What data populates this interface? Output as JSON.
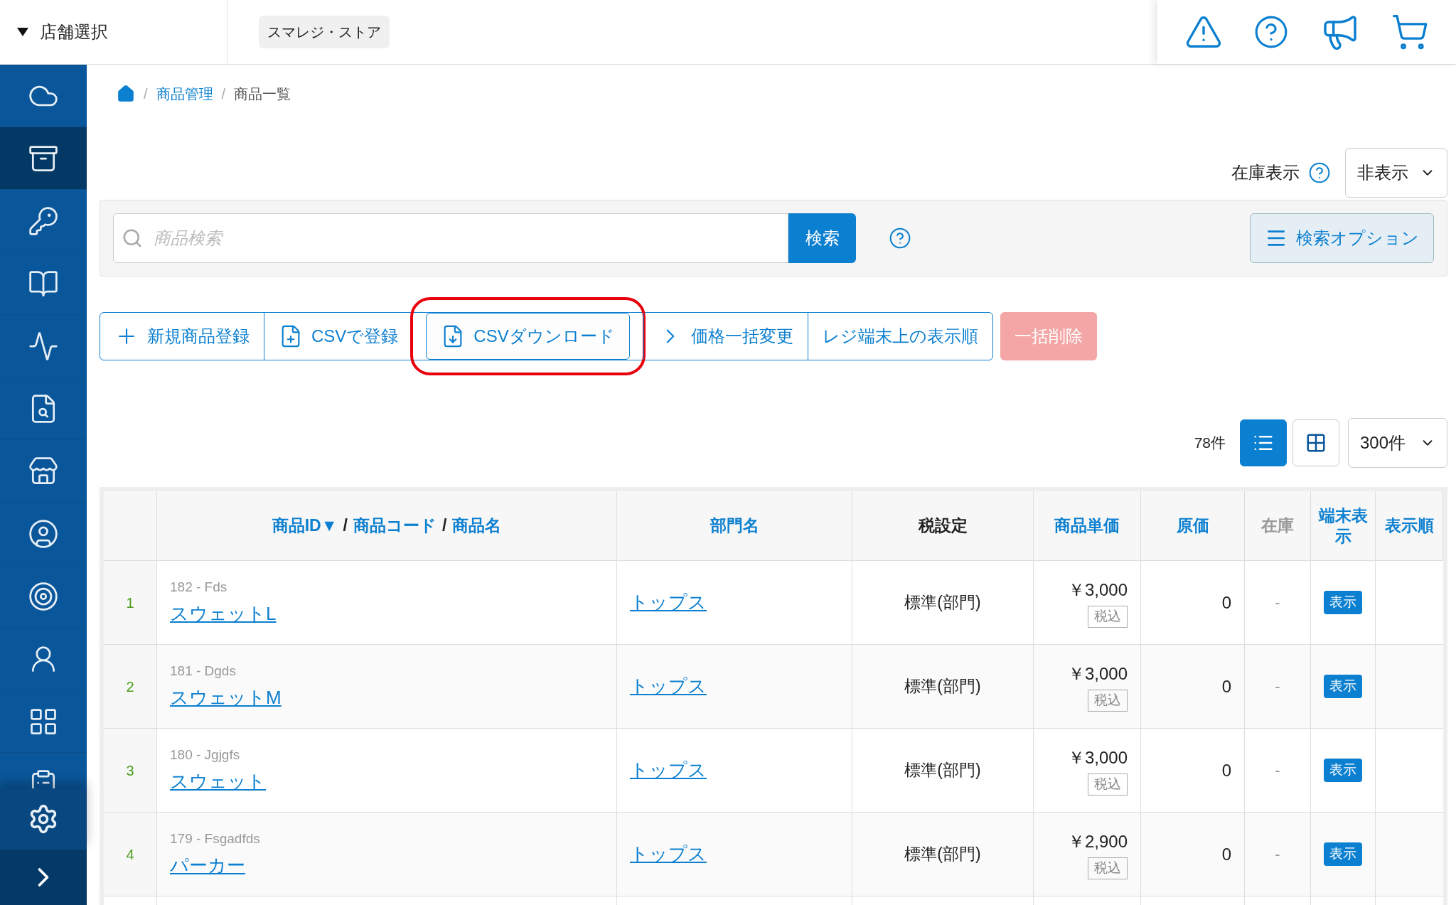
{
  "store_selector": {
    "label": "店舗選択"
  },
  "store_name": "スマレジ・ストア",
  "sidebar": {
    "items": [
      {
        "selected": false
      },
      {
        "selected": true
      },
      {
        "selected": false
      },
      {
        "selected": false
      },
      {
        "selected": false
      },
      {
        "selected": false
      },
      {
        "selected": false
      },
      {
        "selected": false
      },
      {
        "selected": false
      },
      {
        "selected": false
      },
      {
        "selected": false
      },
      {
        "selected": false
      }
    ]
  },
  "breadcrumb": [
    {
      "label": "商品管理",
      "kind": "link"
    },
    {
      "label": "商品一覧",
      "kind": "current"
    }
  ],
  "breadcrumb_separator": "/",
  "stock_display": {
    "label": "在庫表示",
    "value": "非表示"
  },
  "search": {
    "placeholder": "商品検索",
    "button": "検索"
  },
  "search_options": "検索オプション",
  "actions": [
    {
      "label": "新規商品登録",
      "disabled": false,
      "highlighted": false
    },
    {
      "label": "CSVで登録",
      "disabled": false,
      "highlighted": false
    },
    {
      "label": "CSVダウンロード",
      "disabled": false,
      "highlighted": true
    },
    {
      "label": "価格一括変更",
      "disabled": false,
      "highlighted": false
    },
    {
      "label": "レジ端末上の表示順",
      "disabled": false,
      "highlighted": false
    },
    {
      "label": "一括削除",
      "disabled": true,
      "highlighted": false
    }
  ],
  "count": "78件",
  "views": [
    {
      "selected": true
    },
    {
      "selected": false
    }
  ],
  "page_size": "300件",
  "table": {
    "columns": [
      {
        "kind": "link",
        "parts": [
          "商品ID▼",
          "商品コード",
          "商品名"
        ],
        "separator": "/"
      },
      {
        "kind": "link",
        "label": "部門名"
      },
      {
        "kind": "plain",
        "label": "税設定"
      },
      {
        "kind": "link",
        "label": "商品単価"
      },
      {
        "kind": "link",
        "label": "原価"
      },
      {
        "kind": "muted",
        "label": "在庫"
      },
      {
        "kind": "link",
        "label": "端末表示"
      },
      {
        "kind": "link",
        "label": "表示順"
      }
    ],
    "rows": [
      {
        "index": "1",
        "code": "182 - Fds",
        "name": "スウェットL",
        "department": "トップス",
        "tax": "標準(部門)",
        "price": "￥3,000",
        "tax_badge": "税込",
        "cost": "0",
        "stock": "-",
        "display": "表示"
      },
      {
        "index": "2",
        "code": "181 - Dgds",
        "name": "スウェットM",
        "department": "トップス",
        "tax": "標準(部門)",
        "price": "￥3,000",
        "tax_badge": "税込",
        "cost": "0",
        "stock": "-",
        "display": "表示"
      },
      {
        "index": "3",
        "code": "180 - Jgjgfs",
        "name": "スウェット",
        "department": "トップス",
        "tax": "標準(部門)",
        "price": "￥3,000",
        "tax_badge": "税込",
        "cost": "0",
        "stock": "-",
        "display": "表示"
      },
      {
        "index": "4",
        "code": "179 - Fsgadfds",
        "name": "パーカー",
        "department": "トップス",
        "tax": "標準(部門)",
        "price": "￥2,900",
        "tax_badge": "税込",
        "cost": "0",
        "stock": "-",
        "display": "表示"
      }
    ]
  }
}
